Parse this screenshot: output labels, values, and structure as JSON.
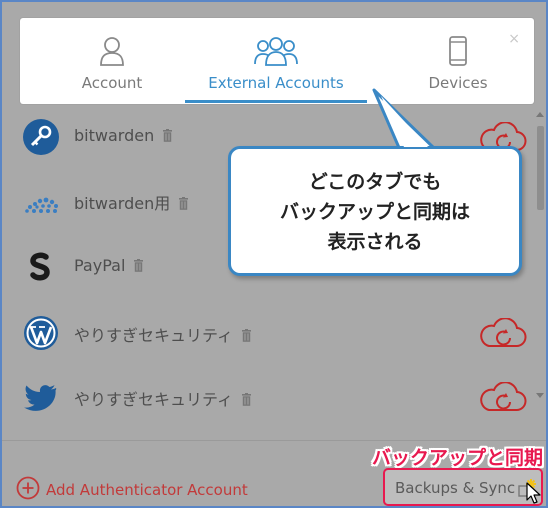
{
  "window": {
    "close_glyph": "×"
  },
  "tabs": [
    {
      "label": "Account",
      "icon": "person-icon",
      "active": false
    },
    {
      "label": "External Accounts",
      "icon": "people-icon",
      "active": true
    },
    {
      "label": "Devices",
      "icon": "phone-icon",
      "active": false
    }
  ],
  "accounts": [
    {
      "name": "bitwarden",
      "logo": "bitwarden-key-icon"
    },
    {
      "name": "bitwarden用",
      "logo": "cloud-dots-icon"
    },
    {
      "name": "PayPal",
      "logo": "paypal-icon"
    },
    {
      "name": "やりすぎセキュリティ",
      "logo": "wordpress-icon"
    },
    {
      "name": "やりすぎセキュリティ",
      "logo": "twitter-bird-icon"
    }
  ],
  "footer": {
    "add_label": "Add Authenticator Account",
    "backup_label": "Backups & Sync"
  },
  "annotation": {
    "callout_lines": [
      "どこのタブでも",
      "バックアップと同期は",
      "表示される"
    ],
    "button_label": "バックアップと同期"
  },
  "colors": {
    "accent_blue": "#3a8ec9",
    "annotation_red": "#e8194f",
    "sync_red": "#c62828",
    "add_red": "#c23a3a"
  }
}
